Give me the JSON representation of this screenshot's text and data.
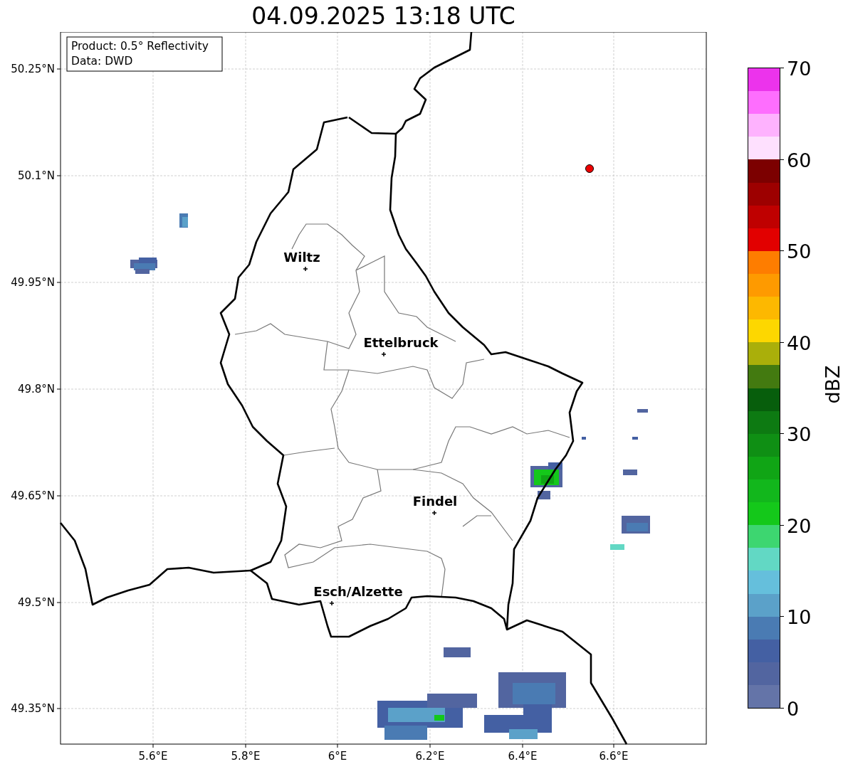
{
  "title": "04.09.2025 13:18 UTC",
  "info_box": [
    "Product: 0.5° Reflectivity",
    "Data: DWD"
  ],
  "lat_ticks": [
    "50.25°N",
    "50.1°N",
    "49.95°N",
    "49.8°N",
    "49.65°N",
    "49.5°N",
    "49.35°N"
  ],
  "lon_ticks": [
    "5.6°E",
    "5.8°E",
    "6°E",
    "6.2°E",
    "6.4°E",
    "6.6°E"
  ],
  "cities": [
    {
      "name": "Wiltz"
    },
    {
      "name": "Ettelbruck"
    },
    {
      "name": "Findel"
    },
    {
      "name": "Esch/Alzette"
    }
  ],
  "colorbar": {
    "label": "dBZ",
    "ticks": [
      "70",
      "60",
      "50",
      "40",
      "30",
      "20",
      "10",
      "0"
    ],
    "bins": [
      {
        "color": "#ec33ec"
      },
      {
        "color": "#fe6efe"
      },
      {
        "color": "#feb2fe"
      },
      {
        "color": "#fee0fe"
      },
      {
        "color": "#7c0000"
      },
      {
        "color": "#9d0000"
      },
      {
        "color": "#bf0000"
      },
      {
        "color": "#e20000"
      },
      {
        "color": "#fe7d00"
      },
      {
        "color": "#fe9a00"
      },
      {
        "color": "#fdb800"
      },
      {
        "color": "#fdd700"
      },
      {
        "color": "#aaaf0a"
      },
      {
        "color": "#437a10"
      },
      {
        "color": "#075e0c"
      },
      {
        "color": "#0d7a12"
      },
      {
        "color": "#0f8f14"
      },
      {
        "color": "#10a515"
      },
      {
        "color": "#12b71c"
      },
      {
        "color": "#14c81a"
      },
      {
        "color": "#3dd670"
      },
      {
        "color": "#62d8c4"
      },
      {
        "color": "#65bfdc"
      },
      {
        "color": "#5ba1c9"
      },
      {
        "color": "#4a7bb3"
      },
      {
        "color": "#4460a3"
      },
      {
        "color": "#5265a0"
      },
      {
        "color": "#6474a8"
      }
    ]
  }
}
